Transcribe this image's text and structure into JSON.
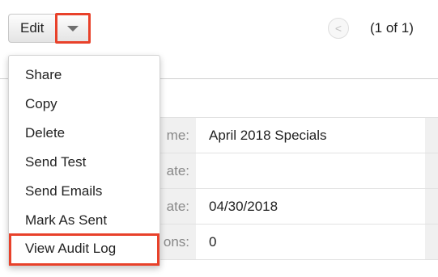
{
  "toolbar": {
    "edit_label": "Edit",
    "caret_icon": "chevron-down-icon",
    "highlight_color": "#e8412a"
  },
  "pager": {
    "prev_icon": "chevron-left-icon",
    "prev_glyph": "<",
    "count": "(1 of 1)"
  },
  "actions_menu": {
    "items": [
      {
        "label": "Share"
      },
      {
        "label": "Copy"
      },
      {
        "label": "Delete"
      },
      {
        "label": "Send Test"
      },
      {
        "label": "Send Emails"
      },
      {
        "label": "Mark As Sent"
      },
      {
        "label": "View Audit Log",
        "highlighted": true
      }
    ]
  },
  "detail": {
    "rows": [
      {
        "label_visible": "me:",
        "value": "April 2018 Specials"
      },
      {
        "label_visible": "ate:",
        "value": ""
      },
      {
        "label_visible": "ate:",
        "value": "04/30/2018"
      },
      {
        "label_visible": "ons:",
        "value": "0"
      }
    ]
  }
}
